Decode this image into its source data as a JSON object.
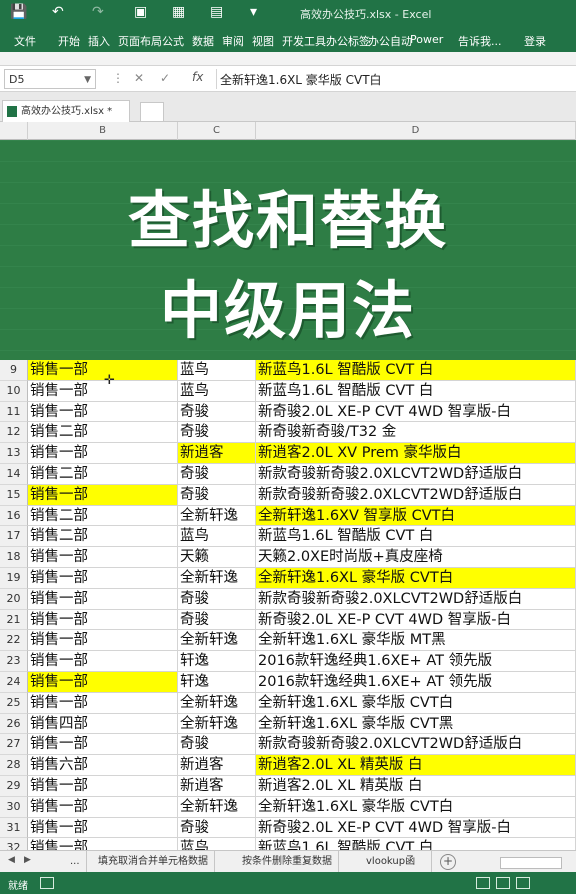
{
  "title_bar": {
    "document_title": "高效办公技巧.xlsx - Excel",
    "save_icon": "save-icon",
    "undo_icon": "undo-icon",
    "redo_icon": "redo-icon"
  },
  "ribbon_tabs": [
    "文件",
    "开始",
    "插入",
    "页面布局",
    "公式",
    "数据",
    "审阅",
    "视图",
    "开发工具",
    "办公标签",
    "办公自动",
    "Power",
    "告诉我...",
    "登录"
  ],
  "formula_bar": {
    "name_box": "D5",
    "fx_label": "fx",
    "value": "全新轩逸1.6XL 豪华版 CVT白"
  },
  "workbook_tab": {
    "label": "高效办公技巧.xlsx *"
  },
  "columns": [
    "B",
    "C",
    "D"
  ],
  "banner": {
    "line1": "查找和替换",
    "line2": "中级用法"
  },
  "rows": [
    {
      "n": "9",
      "b": "销售一部",
      "c": "蓝鸟",
      "d": "新蓝鸟1.6L 智酷版 CVT 白",
      "hb": true,
      "hc": false,
      "hd": true
    },
    {
      "n": "10",
      "b": "销售一部",
      "c": "蓝鸟",
      "d": "新蓝鸟1.6L 智酷版 CVT 白",
      "hb": false,
      "hc": false,
      "hd": false
    },
    {
      "n": "11",
      "b": "销售一部",
      "c": "奇骏",
      "d": "新奇骏2.0L XE-P CVT 4WD 智享版-白",
      "hb": false,
      "hc": false,
      "hd": false
    },
    {
      "n": "12",
      "b": "销售二部",
      "c": "奇骏",
      "d": "新奇骏新奇骏/T32 金",
      "hb": false,
      "hc": false,
      "hd": false
    },
    {
      "n": "13",
      "b": "销售一部",
      "c": "新逍客",
      "d": "新逍客2.0L XV Prem 豪华版白",
      "hb": false,
      "hc": true,
      "hd": true
    },
    {
      "n": "14",
      "b": "销售二部",
      "c": "奇骏",
      "d": "新款奇骏新奇骏2.0XLCVT2WD舒适版白",
      "hb": false,
      "hc": false,
      "hd": false
    },
    {
      "n": "15",
      "b": "销售一部",
      "c": "奇骏",
      "d": "新款奇骏新奇骏2.0XLCVT2WD舒适版白",
      "hb": true,
      "hc": false,
      "hd": false
    },
    {
      "n": "16",
      "b": "销售二部",
      "c": "全新轩逸",
      "d": "全新轩逸1.6XV 智享版 CVT白",
      "hb": false,
      "hc": false,
      "hd": true
    },
    {
      "n": "17",
      "b": "销售二部",
      "c": "蓝鸟",
      "d": "新蓝鸟1.6L 智酷版 CVT 白",
      "hb": false,
      "hc": false,
      "hd": false
    },
    {
      "n": "18",
      "b": "销售一部",
      "c": "天籁",
      "d": "天籁2.0XE时尚版+真皮座椅",
      "hb": false,
      "hc": false,
      "hd": false
    },
    {
      "n": "19",
      "b": "销售一部",
      "c": "全新轩逸",
      "d": "全新轩逸1.6XL 豪华版 CVT白",
      "hb": false,
      "hc": false,
      "hd": true
    },
    {
      "n": "20",
      "b": "销售一部",
      "c": "奇骏",
      "d": "新款奇骏新奇骏2.0XLCVT2WD舒适版白",
      "hb": false,
      "hc": false,
      "hd": false
    },
    {
      "n": "21",
      "b": "销售一部",
      "c": "奇骏",
      "d": "新奇骏2.0L XE-P CVT 4WD 智享版-白",
      "hb": false,
      "hc": false,
      "hd": false
    },
    {
      "n": "22",
      "b": "销售一部",
      "c": "全新轩逸",
      "d": "全新轩逸1.6XL 豪华版 MT黑",
      "hb": false,
      "hc": false,
      "hd": false
    },
    {
      "n": "23",
      "b": "销售一部",
      "c": "轩逸",
      "d": "2016款轩逸经典1.6XE+ AT 领先版",
      "hb": false,
      "hc": false,
      "hd": false
    },
    {
      "n": "24",
      "b": "销售一部",
      "c": "轩逸",
      "d": "2016款轩逸经典1.6XE+ AT 领先版",
      "hb": true,
      "hc": false,
      "hd": false
    },
    {
      "n": "25",
      "b": "销售一部",
      "c": "全新轩逸",
      "d": "全新轩逸1.6XL 豪华版 CVT白",
      "hb": false,
      "hc": false,
      "hd": false
    },
    {
      "n": "26",
      "b": "销售四部",
      "c": "全新轩逸",
      "d": "全新轩逸1.6XL 豪华版 CVT黑",
      "hb": false,
      "hc": false,
      "hd": false
    },
    {
      "n": "27",
      "b": "销售一部",
      "c": "奇骏",
      "d": "新款奇骏新奇骏2.0XLCVT2WD舒适版白",
      "hb": false,
      "hc": false,
      "hd": false
    },
    {
      "n": "28",
      "b": "销售六部",
      "c": "新逍客",
      "d": "新逍客2.0L XL 精英版 白",
      "hb": false,
      "hc": false,
      "hd": true
    },
    {
      "n": "29",
      "b": "销售一部",
      "c": "新逍客",
      "d": "新逍客2.0L XL 精英版 白",
      "hb": false,
      "hc": false,
      "hd": false
    },
    {
      "n": "30",
      "b": "销售一部",
      "c": "全新轩逸",
      "d": "全新轩逸1.6XL 豪华版 CVT白",
      "hb": false,
      "hc": false,
      "hd": false
    },
    {
      "n": "31",
      "b": "销售一部",
      "c": "奇骏",
      "d": "新奇骏2.0L XE-P CVT 4WD 智享版-白",
      "hb": false,
      "hc": false,
      "hd": false
    },
    {
      "n": "32",
      "b": "销售一部",
      "c": "蓝鸟",
      "d": "新蓝鸟1.6L 智酷版 CVT 白",
      "hb": false,
      "hc": false,
      "hd": false
    }
  ],
  "sheet_tabs": [
    "...",
    "填充取消合并单元格数据",
    "按条件删除重复数据",
    "vlookup函"
  ],
  "status_bar": {
    "mode": "就绪"
  },
  "colors": {
    "excel_green": "#217346",
    "banner_green": "#2e7d45",
    "highlight_yellow": "#ffff00"
  }
}
